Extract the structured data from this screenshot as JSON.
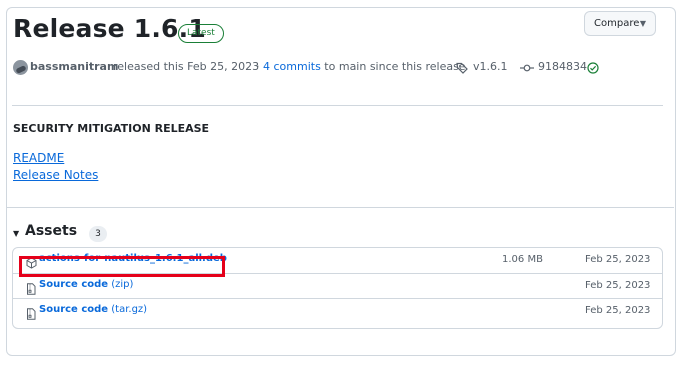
{
  "release": {
    "title": "Release 1.6.1",
    "badge": "Latest",
    "compare_label": "Compare",
    "author": "bassmanitram",
    "released_text": "released this Feb 25, 2023",
    "commits_prefix": "· ",
    "commits_link": "4 commits",
    "commits_suffix": " to main since this release",
    "tag": "v1.6.1",
    "commit_sha": "9184834"
  },
  "notes": {
    "heading": "SECURITY MITIGATION RELEASE",
    "links": [
      "README",
      "Release Notes"
    ]
  },
  "assets": {
    "title": "Assets",
    "count": "3",
    "items": [
      {
        "name": "actions-for-nautilus_1.6.1_all.deb",
        "kind": "",
        "size": "1.06 MB",
        "date": "Feb 25, 2023",
        "icon": "package-icon"
      },
      {
        "name": "Source code",
        "kind": " (zip)",
        "size": "",
        "date": "Feb 25, 2023",
        "icon": "file-zip-icon"
      },
      {
        "name": "Source code",
        "kind": " (tar.gz)",
        "size": "",
        "date": "Feb 25, 2023",
        "icon": "file-zip-icon"
      }
    ]
  },
  "colors": {
    "link": "#0969da",
    "latest_badge": "#1a7f37",
    "highlight_box": "#e5001a"
  }
}
